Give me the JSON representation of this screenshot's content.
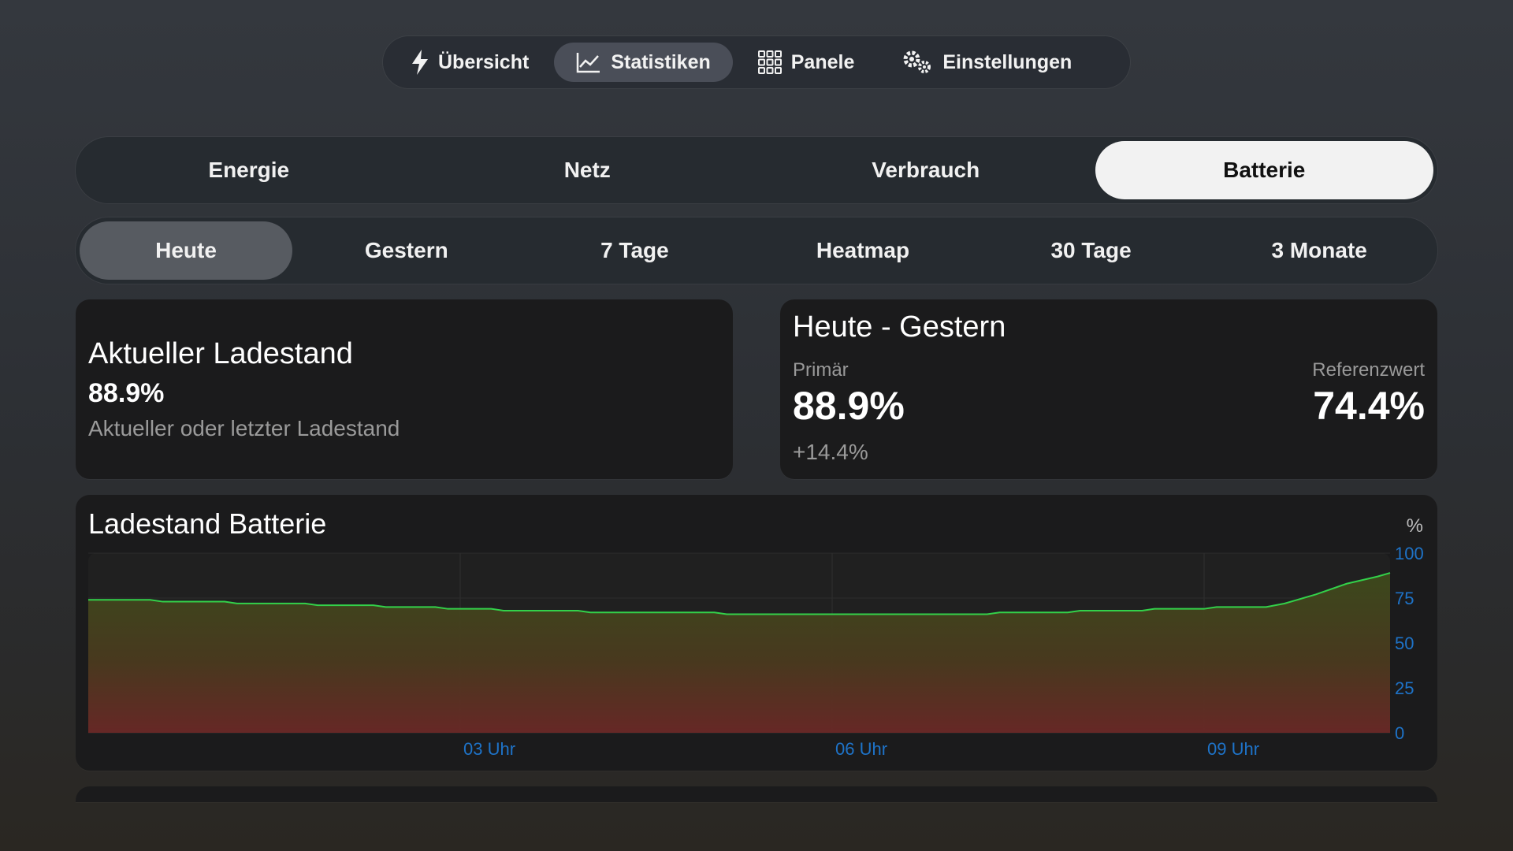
{
  "nav": {
    "items": [
      {
        "label": "Übersicht",
        "icon": "bolt-icon",
        "active": false
      },
      {
        "label": "Statistiken",
        "icon": "chart-line-icon",
        "active": true
      },
      {
        "label": "Panele",
        "icon": "grid-icon",
        "active": false
      },
      {
        "label": "Einstellungen",
        "icon": "gears-icon",
        "active": false
      }
    ]
  },
  "categories": [
    {
      "label": "Energie",
      "active": false
    },
    {
      "label": "Netz",
      "active": false
    },
    {
      "label": "Verbrauch",
      "active": false
    },
    {
      "label": "Batterie",
      "active": true
    }
  ],
  "ranges": [
    {
      "label": "Heute",
      "active": true
    },
    {
      "label": "Gestern",
      "active": false
    },
    {
      "label": "7 Tage",
      "active": false
    },
    {
      "label": "Heatmap",
      "active": false
    },
    {
      "label": "30 Tage",
      "active": false
    },
    {
      "label": "3 Monate",
      "active": false
    }
  ],
  "soc_card": {
    "title": "Aktueller Ladestand",
    "value": "88.9%",
    "subtitle": "Aktueller oder letzter Ladestand"
  },
  "compare_card": {
    "title": "Heute - Gestern",
    "primary_label": "Primär",
    "primary_value": "88.9%",
    "delta": "+14.4%",
    "reference_label": "Referenzwert",
    "reference_value": "74.4%"
  },
  "chart_card": {
    "title": "Ladestand Batterie",
    "unit": "%"
  },
  "colors": {
    "line": "#33d14a",
    "tick": "#1e73c8",
    "fill_top": "#3d4a1c",
    "fill_bottom": "#6a2826"
  },
  "chart_data": {
    "type": "area",
    "title": "Ladestand Batterie",
    "ylabel": "%",
    "ylim": [
      0,
      100
    ],
    "yticks": [
      0,
      25,
      50,
      75,
      100
    ],
    "xlim": [
      0,
      10.5
    ],
    "xticks": [
      {
        "value": 3,
        "label": "03 Uhr"
      },
      {
        "value": 6,
        "label": "06 Uhr"
      },
      {
        "value": 9,
        "label": "09 Uhr"
      }
    ],
    "grid": true,
    "series": [
      {
        "x": [
          0,
          0.5,
          0.6,
          1.1,
          1.2,
          1.75,
          1.85,
          2.3,
          2.4,
          2.8,
          2.9,
          3.25,
          3.35,
          3.95,
          4.05,
          5.05,
          5.15,
          7.25,
          7.35,
          7.9,
          8.0,
          8.5,
          8.6,
          9.0,
          9.1,
          9.5,
          9.65,
          9.9,
          10.15,
          10.4,
          10.5
        ],
        "y": [
          74,
          74,
          73,
          73,
          72,
          72,
          71,
          71,
          70,
          70,
          69,
          69,
          68,
          68,
          67,
          67,
          66,
          66,
          67,
          67,
          68,
          68,
          69,
          69,
          70,
          70,
          72,
          77,
          83,
          87,
          89
        ]
      }
    ]
  }
}
